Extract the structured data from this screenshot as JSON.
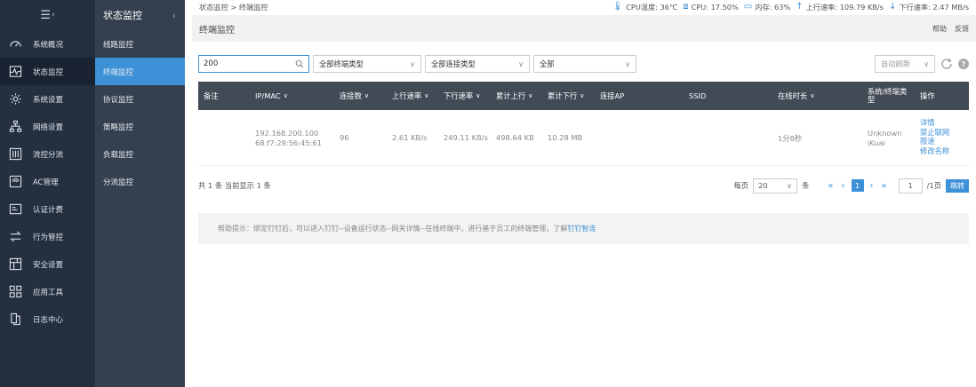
{
  "sidebar": {
    "toggle_icon": "collapse-menu-icon",
    "items": [
      {
        "label": "系统概况",
        "icon": "dashboard-icon"
      },
      {
        "label": "状态监控",
        "icon": "monitor-icon"
      },
      {
        "label": "系统设置",
        "icon": "gear-icon"
      },
      {
        "label": "网络设置",
        "icon": "network-icon"
      },
      {
        "label": "流控分流",
        "icon": "flow-control-icon"
      },
      {
        "label": "AC管理",
        "icon": "ac-icon"
      },
      {
        "label": "认证计费",
        "icon": "auth-icon"
      },
      {
        "label": "行为管控",
        "icon": "behavior-icon"
      },
      {
        "label": "安全设置",
        "icon": "security-icon"
      },
      {
        "label": "应用工具",
        "icon": "tools-icon"
      },
      {
        "label": "日志中心",
        "icon": "log-icon"
      }
    ]
  },
  "subnav": {
    "title": "状态监控",
    "items": [
      "线路监控",
      "终端监控",
      "协议监控",
      "策略监控",
      "负载监控",
      "分流监控"
    ]
  },
  "topbar": {
    "breadcrumb": "状态监控 > 终端监控",
    "cpu_temp": "CPU温度: 36℃",
    "cpu": "CPU: 17.50%",
    "memory": "内存: 63%",
    "upload": "上行速率: 109.79 KB/s",
    "download": "下行速率: 2.47 MB/s"
  },
  "page": {
    "title": "终端监控",
    "help": "帮助",
    "feedback": "反馈"
  },
  "filters": {
    "search_value": "200",
    "terminal_type": "全部终端类型",
    "connection_type": "全部连接类型",
    "scope": "全部",
    "auto_refresh": "自动刷新"
  },
  "table": {
    "headers": {
      "remark": "备注",
      "ipmac": "IP/MAC",
      "conns": "连接数",
      "up": "上行速率",
      "down": "下行速率",
      "total_up": "累计上行",
      "total_down": "累计下行",
      "ap": "连接AP",
      "ssid": "SSID",
      "online": "在线时长",
      "os": "系统/终端类型",
      "ops": "操作"
    },
    "row": {
      "remark": "",
      "ip": "192.168.200.100",
      "mac": "68:f7:28:56:45:61",
      "conns": "96",
      "up": "2.61 KB/s",
      "down": "249.11 KB/s",
      "total_up": "498.64 KB",
      "total_down": "10.28 MB",
      "ap": "",
      "ssid": "",
      "online": "1分8秒",
      "os1": "Unknown",
      "os2": "iKuai",
      "ops": [
        "详情",
        "禁止联网",
        "限速",
        "修改名称"
      ]
    }
  },
  "pager": {
    "summary": "共 1 条 当前显示 1 条",
    "per_page_label": "每页",
    "per_page": "20",
    "unit": "条",
    "current": "1",
    "goto_value": "1",
    "total_pages": "/1页",
    "go": "跳转"
  },
  "tip": {
    "text": "帮助提示：绑定钉钉后，可以进入钉钉--设备运行状态--网关详情--在线终端中，进行基于员工的终端管理，了解",
    "link": "钉钉智连"
  },
  "colors": {
    "accent": "#3d91d6",
    "sidebar_dark": "#243040",
    "sidebar_sub": "#34404f",
    "table_header": "#424a56"
  }
}
